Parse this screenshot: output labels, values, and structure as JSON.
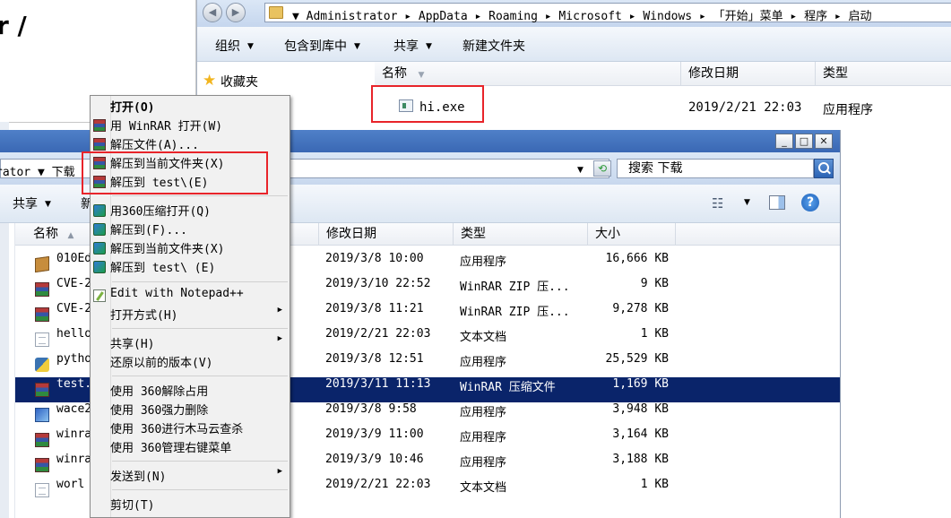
{
  "page_fragment": {
    "title": "r /"
  },
  "top_window": {
    "breadcrumb": "▼ Administrator ▸ AppData ▸ Roaming ▸ Microsoft ▸ Windows ▸ 「开始」菜单 ▸ 程序 ▸ 启动",
    "toolbar": {
      "organize": "组织",
      "include_library": "包含到库中",
      "share": "共享",
      "new_folder": "新建文件夹"
    },
    "nav": {
      "favorites": "收藏夹"
    },
    "columns": {
      "name": "名称",
      "modified": "修改日期",
      "type": "类型"
    },
    "file": {
      "name": "hi.exe",
      "modified": "2019/2/21 22:03",
      "type": "应用程序"
    }
  },
  "main_window": {
    "address": "rator ▼ 下载",
    "search_placeholder": "搜索 下载",
    "toolbar": {
      "share": "共享",
      "new_partial": "新"
    },
    "columns": {
      "name": "名称",
      "modified": "修改日期",
      "type": "类型",
      "size": "大小"
    },
    "files": [
      {
        "name": "010Ed",
        "icon": "box-icon",
        "modified": "2019/3/8 10:00",
        "type": "应用程序",
        "size": "16,666 KB"
      },
      {
        "name": "CVE-2",
        "icon": "winrar-icon",
        "modified": "2019/3/10 22:52",
        "type": "WinRAR ZIP 压...",
        "size": "9 KB"
      },
      {
        "name": "CVE-2",
        "icon": "winrar-icon",
        "modified": "2019/3/8 11:21",
        "type": "WinRAR ZIP 压...",
        "size": "9,278 KB"
      },
      {
        "name": "hello",
        "icon": "text-file-icon",
        "modified": "2019/2/21 22:03",
        "type": "文本文档",
        "size": "1 KB"
      },
      {
        "name": "pytho",
        "icon": "python-icon",
        "modified": "2019/3/8 12:51",
        "type": "应用程序",
        "size": "25,529 KB"
      },
      {
        "name": "test.",
        "icon": "winrar-icon",
        "modified": "2019/3/11 11:13",
        "type": "WinRAR 压缩文件",
        "size": "1,169 KB",
        "selected": true
      },
      {
        "name": "wace2",
        "icon": "installer-icon",
        "modified": "2019/3/8 9:58",
        "type": "应用程序",
        "size": "3,948 KB"
      },
      {
        "name": "winra",
        "icon": "winrar-icon",
        "modified": "2019/3/9 11:00",
        "type": "应用程序",
        "size": "3,164 KB"
      },
      {
        "name": "winra",
        "icon": "winrar-icon",
        "modified": "2019/3/9 10:46",
        "type": "应用程序",
        "size": "3,188 KB"
      },
      {
        "name": "worl",
        "icon": "text-file-icon",
        "modified": "2019/2/21 22:03",
        "type": "文本文档",
        "size": "1 KB"
      }
    ]
  },
  "context_menu": {
    "items": [
      {
        "label": "打开(O)",
        "bold": true,
        "icon": ""
      },
      {
        "label": "用 WinRAR 打开(W)",
        "icon": "winrar-icon"
      },
      {
        "label": "解压文件(A)...",
        "icon": "winrar-icon"
      },
      {
        "label": "解压到当前文件夹(X)",
        "icon": "winrar-icon"
      },
      {
        "label": "解压到 test\\(E)",
        "icon": "winrar-icon"
      },
      {
        "label": "用360压缩打开(Q)",
        "icon": "360zip-icon"
      },
      {
        "label": "解压到(F)...",
        "icon": "360zip-icon"
      },
      {
        "label": "解压到当前文件夹(X)",
        "icon": "360zip-icon"
      },
      {
        "label": "解压到 test\\ (E)",
        "icon": "360zip-icon"
      },
      {
        "label": "Edit with Notepad++",
        "icon": "notepadpp-icon"
      },
      {
        "label": "打开方式(H)",
        "icon": "",
        "submenu": true
      },
      {
        "label": "共享(H)",
        "icon": "",
        "submenu": true
      },
      {
        "label": "还原以前的版本(V)",
        "icon": ""
      },
      {
        "label": "使用 360解除占用",
        "icon": ""
      },
      {
        "label": "使用 360强力删除",
        "icon": ""
      },
      {
        "label": "使用 360进行木马云查杀",
        "icon": ""
      },
      {
        "label": "使用 360管理右键菜单",
        "icon": ""
      },
      {
        "label": "发送到(N)",
        "icon": "",
        "submenu": true
      },
      {
        "label": "剪切(T)",
        "icon": ""
      }
    ]
  },
  "colors": {
    "highlight": "#e8242a",
    "selection": "#0a246a",
    "titlebar": "#3a68b4"
  }
}
